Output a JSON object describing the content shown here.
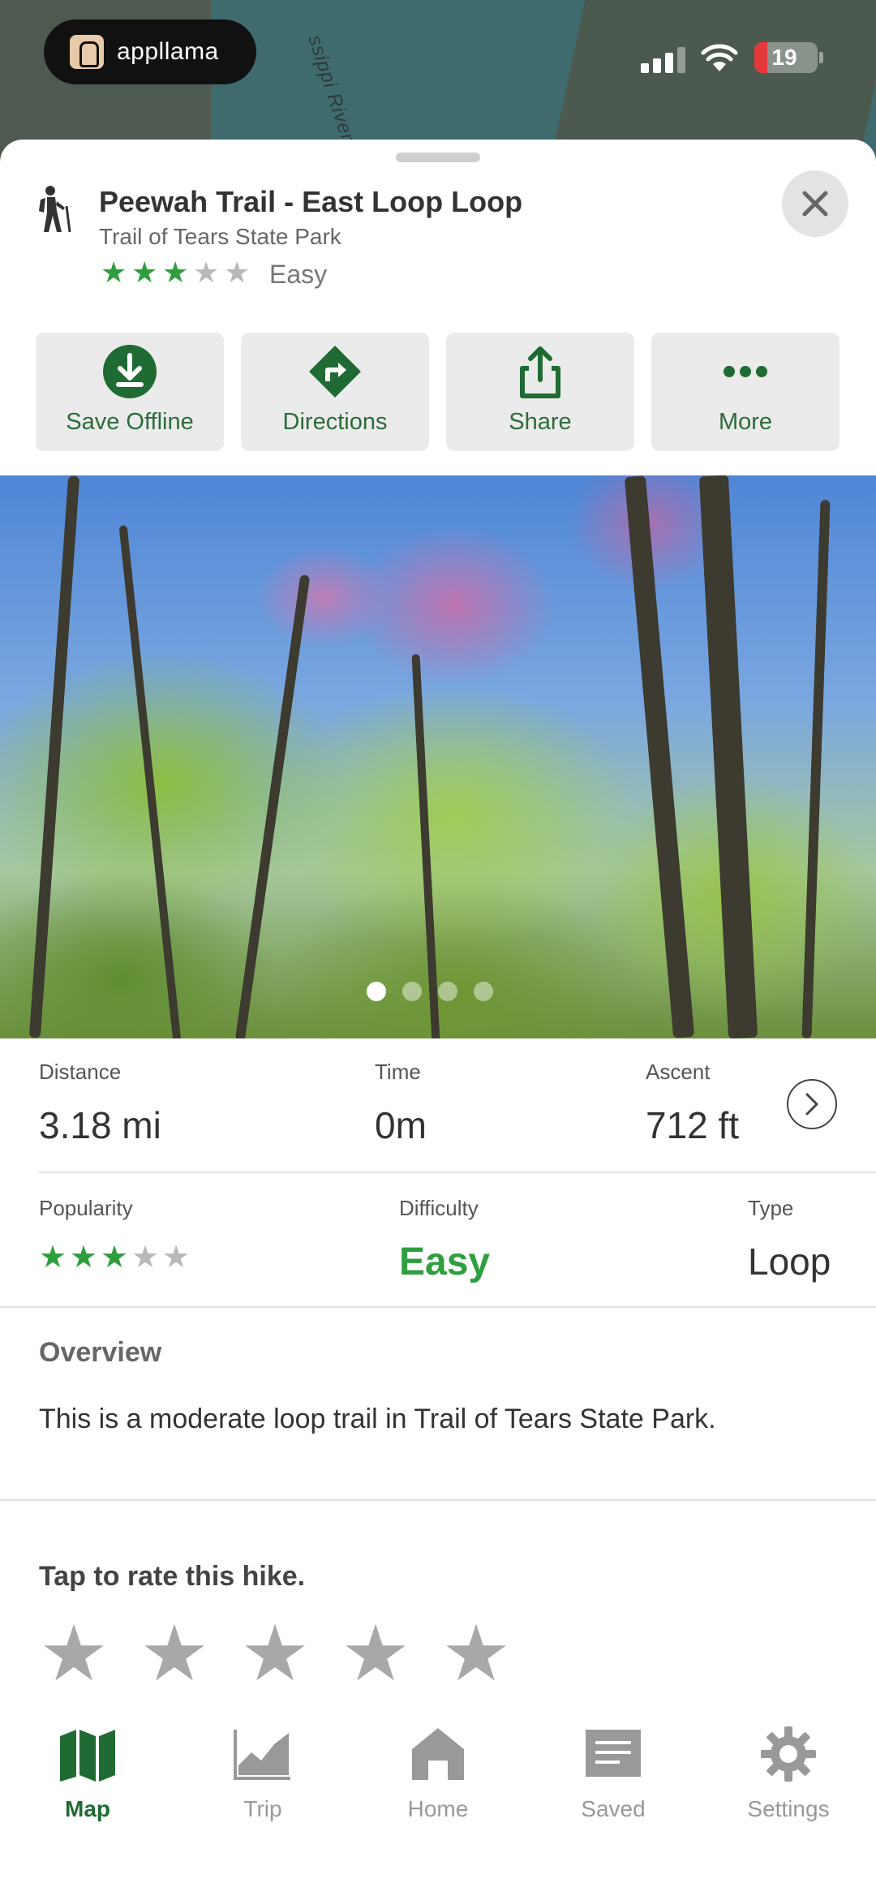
{
  "status_bar": {
    "app_name": "appllama",
    "battery": "19",
    "map_label": "ssippi River"
  },
  "trail": {
    "title": "Peewah Trail - East Loop Loop",
    "park": "Trail of Tears State Park",
    "rating": 3,
    "rating_max": 5,
    "difficulty_label": "Easy"
  },
  "actions": [
    {
      "label": "Save Offline",
      "icon": "download-circle-icon"
    },
    {
      "label": "Directions",
      "icon": "turn-right-diamond-icon"
    },
    {
      "label": "Share",
      "icon": "share-icon"
    },
    {
      "label": "More",
      "icon": "more-dots-icon"
    }
  ],
  "photo": {
    "page_count": 4,
    "current_page": 1
  },
  "stats": {
    "distance_label": "Distance",
    "distance_value": "3.18 mi",
    "time_label": "Time",
    "time_value": "0m",
    "ascent_label": "Ascent",
    "ascent_value": "712 ft",
    "popularity_label": "Popularity",
    "popularity_rating": 3,
    "difficulty_label": "Difficulty",
    "difficulty_value": "Easy",
    "type_label": "Type",
    "type_value": "Loop"
  },
  "overview": {
    "title": "Overview",
    "text": "This is a moderate loop trail in Trail of Tears State Park."
  },
  "rate": {
    "title": "Tap to rate this hike.",
    "stars": 5
  },
  "tabs": [
    {
      "label": "Map",
      "icon": "map-icon",
      "active": true
    },
    {
      "label": "Trip",
      "icon": "trip-chart-icon",
      "active": false
    },
    {
      "label": "Home",
      "icon": "home-icon",
      "active": false
    },
    {
      "label": "Saved",
      "icon": "saved-folder-icon",
      "active": false
    },
    {
      "label": "Settings",
      "icon": "gear-icon",
      "active": false
    }
  ],
  "colors": {
    "accent_green": "#2f9e3f",
    "dark_green": "#1f6b33",
    "button_bg": "#ebebeb"
  }
}
